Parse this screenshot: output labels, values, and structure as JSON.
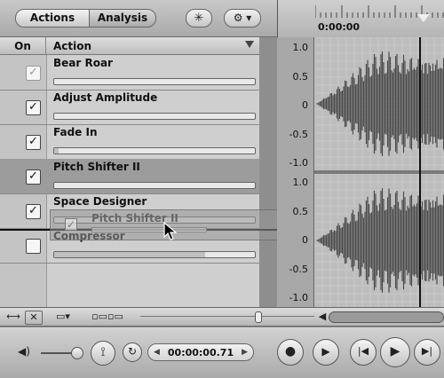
{
  "toolbar": {
    "tab_actions": "Actions",
    "tab_analysis": "Analysis",
    "star_icon": "✳",
    "gear_icon": "⚙ ▾"
  },
  "list_header": {
    "on": "On",
    "action": "Action"
  },
  "rows": [
    {
      "name": "Bear Roar",
      "checked": true,
      "dimmed": true,
      "level": 0.0
    },
    {
      "name": "Adjust Amplitude",
      "checked": true,
      "dimmed": false,
      "level": 0.0
    },
    {
      "name": "Fade In",
      "checked": true,
      "dimmed": false,
      "level": 0.02
    },
    {
      "name": "Pitch Shifter II",
      "checked": true,
      "dimmed": false,
      "level": 0.0,
      "selected": true
    },
    {
      "name": "Space Designer",
      "checked": true,
      "dimmed": false,
      "level": 0.0
    },
    {
      "name": "Compressor",
      "checked": false,
      "dimmed": false,
      "level": 0.75
    }
  ],
  "drag_ghost": {
    "name": "Pitch Shifter II",
    "check": "✓"
  },
  "ruler": {
    "time_label": "0:00:00"
  },
  "axis": {
    "upper_ticks": [
      "1.0",
      "0.5",
      "0",
      "-0.5",
      "-1.0"
    ],
    "lower_ticks": [
      "1.0",
      "0.5",
      "0",
      "-0.5",
      "-1.0"
    ]
  },
  "transport": {
    "timecode": "00:00:00.71",
    "volume_icon": "◀)",
    "loop_icon": "↻",
    "record_icon": "●",
    "play_from_start_icon": "▶",
    "prev_icon": "|◀",
    "play_icon": "▶",
    "next_icon": "▶|"
  },
  "colors": {
    "waveform": "#4d4d4d",
    "grid": "#c9c9c9",
    "selected_row": "#9c9c9c"
  }
}
